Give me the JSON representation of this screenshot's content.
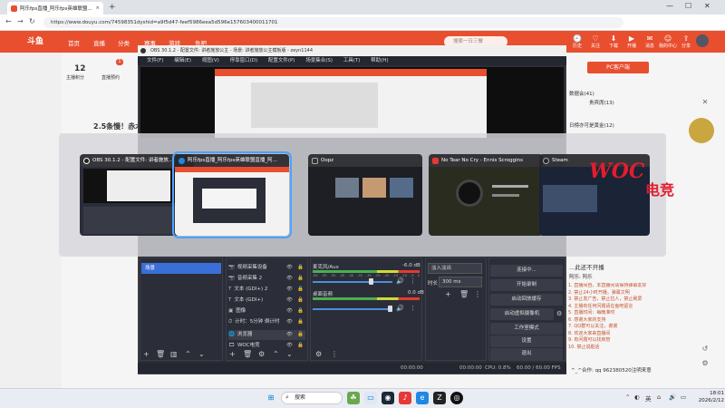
{
  "browser": {
    "tab_title": "阿乐fps直播_阿乐fps英雄联盟...",
    "tab_close": "×",
    "new_tab": "+",
    "url": "https://www.douyu.com/74598351dyshid=a9f5d47-feef5986eea5d596e157603400011701",
    "window_controls": {
      "min": "—",
      "max": "☐",
      "close": "✕"
    },
    "nav": {
      "back": "←",
      "forward": "→",
      "reload": "↻"
    }
  },
  "douyu": {
    "logo": "斗鱼",
    "nav_links": [
      "首页",
      "直播",
      "分类",
      "赛事",
      "游戏",
      "鱼吧"
    ],
    "search_placeholder": "搜索一日三餐",
    "header_icons": [
      "历史",
      "关注",
      "下载",
      "开播",
      "消息",
      "我的中心",
      "分享",
      "Menu"
    ],
    "left_count": "12",
    "left_label1": "主播积分",
    "left_badge": "1",
    "left_label2": "直播预约",
    "headline": "2.5条慢！赤木·",
    "right_panel": [
      "PC客户端",
      "数据会(41)",
      "贵宾席(13)",
      "日榜亦可是黄金(12)"
    ],
    "right_notice_title": "...此还不开播",
    "right_notice_sub": "阿乐: 阿乐",
    "right_notes": [
      "1. 直播间自，本直播间请保持弹幕友好",
      "2. 禁止24小时开播，弹幕文明",
      "3. 禁止发广告，禁止拉人，禁止刷屏",
      "4. 主播有任何问题请在鱼吧留言",
      "5. 直播时间：每晚准时",
      "6. 感谢大家的支持",
      "7. QQ群可以关注，谢谢",
      "8. 欢迎大家来直播间",
      "9. 有问题可以找房管",
      "10. 禁止说脏话"
    ],
    "bottom_text": "^_^合作: qq 962380520注明来意",
    "right_bottom_label": "分享"
  },
  "obs": {
    "title": "OBS 30.1.2 - 配置文件: 讲者施放公主 - 场景: 讲者施放公主模板版 - zeyn1144",
    "menu": [
      "文件(F)",
      "编辑(E)",
      "视图(V)",
      "停靠窗口(D)",
      "配置文件(P)",
      "场景集合(S)",
      "工具(T)",
      "帮助(H)"
    ],
    "scenes": [
      "场景"
    ],
    "sources": [
      {
        "icon": "📷",
        "label": "视频采集设备"
      },
      {
        "icon": "📷",
        "label": "音频采集 2"
      },
      {
        "icon": "T",
        "label": "文本 (GDI+) 2"
      },
      {
        "icon": "T",
        "label": "文本 (GDI+)"
      },
      {
        "icon": "▣",
        "label": "图像"
      },
      {
        "icon": "⏱",
        "label": "计时：5分钟 倒计时"
      },
      {
        "icon": "🌐",
        "label": "浏览器"
      },
      {
        "icon": "🎞",
        "label": "WOC电竞"
      }
    ],
    "mixer": [
      {
        "name": "麦克风/Aux",
        "value": "-6.0 dB",
        "level": 0.75
      },
      {
        "name": "桌面音频",
        "value": "0.0 dB",
        "level": 1.0
      }
    ],
    "mixer_ticks": [
      "-60",
      "-55",
      "-50",
      "-45",
      "-40",
      "-35",
      "-30",
      "-25",
      "-20",
      "-15",
      "-10",
      "-5",
      "0"
    ],
    "transition_type": "淡入淡出",
    "duration_label": "时长",
    "duration_value": "300 ms",
    "controls": [
      "连接中...",
      "开始录制",
      "启动回放缓存",
      "启动虚拟摄像机",
      "工作室模式",
      "设置",
      "退出"
    ],
    "status": {
      "rec_time": "00:00:00",
      "stream_time": "00:00:00",
      "cpu": "CPU: 0.8%",
      "fps": "60.00 / 60.00 FPS"
    }
  },
  "switcher": {
    "cards": [
      {
        "title": "OBS 30.1.2 - 配置文件: 讲者施放...",
        "icon_color": "#222",
        "selected": false
      },
      {
        "title": "阿乐fps直播_阿乐fps英雄联盟直播_阿...",
        "icon_color": "#1e88e5",
        "selected": true
      },
      {
        "title": "Oopz",
        "icon_color": "#333",
        "selected": false
      },
      {
        "title": "No Tear No Cry - Ennis Scroggins",
        "icon_color": "#e53935",
        "selected": false
      },
      {
        "title": "Steam",
        "icon_color": "#1b2838",
        "selected": false
      }
    ]
  },
  "overlay": {
    "woc": "WOC",
    "woc_cn": "电竞"
  },
  "taskbar": {
    "search": "搜索",
    "tray_lang": "英",
    "time": "18:01",
    "date": "2026/2/12"
  }
}
